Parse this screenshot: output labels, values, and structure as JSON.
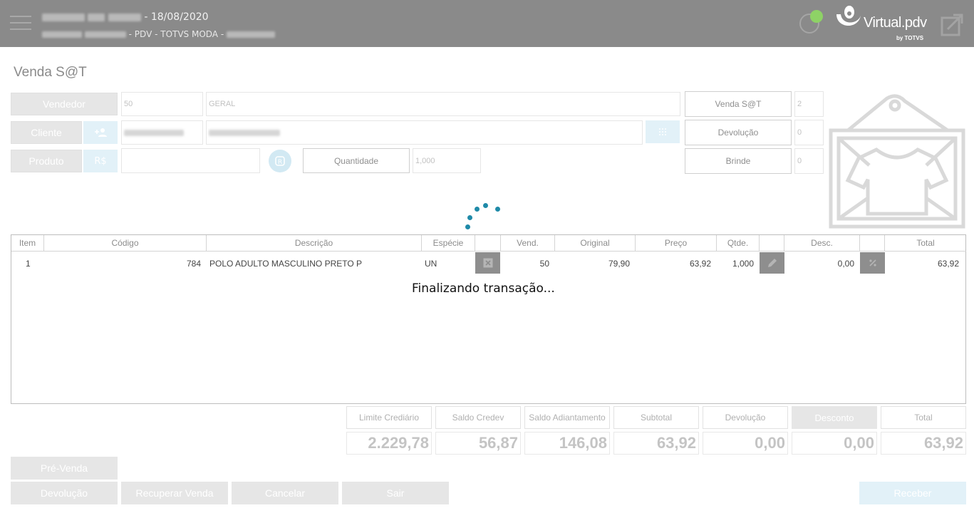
{
  "header": {
    "date_suffix": "- 18/08/2020",
    "subtitle_middle": "- PDV - TOTVS MODA -",
    "logo_text": "Virtual.pdv",
    "logo_sub": "by TOTVS"
  },
  "page_title": "Venda S@T",
  "form": {
    "vendedor_label": "Vendedor",
    "vendedor_code": "50",
    "vendedor_name": "GERAL",
    "cliente_label": "Cliente",
    "produto_label": "Produto",
    "currency_label": "R$",
    "quantidade_label": "Quantidade",
    "quantidade_value": "1,000"
  },
  "counters": [
    {
      "label": "Venda S@T",
      "value": "2"
    },
    {
      "label": "Devolução",
      "value": "0"
    },
    {
      "label": "Brinde",
      "value": "0"
    }
  ],
  "table": {
    "headers": {
      "item": "Item",
      "codigo": "Código",
      "descricao": "Descrição",
      "especie": "Espécie",
      "vend": "Vend.",
      "original": "Original",
      "preco": "Preço",
      "qtde": "Qtde.",
      "desc": "Desc.",
      "total": "Total"
    },
    "rows": [
      {
        "item": "1",
        "codigo": "784",
        "descricao": "POLO ADULTO MASCULINO PRETO P",
        "especie": "UN",
        "vend": "50",
        "original": "79,90",
        "preco": "63,92",
        "qtde": "1,000",
        "desc": "0,00",
        "total": "63,92"
      }
    ]
  },
  "loading_text": "Finalizando transação...",
  "totals": [
    {
      "label": "Limite Crediário",
      "value": "2.229,78"
    },
    {
      "label": "Saldo Credev",
      "value": "56,87"
    },
    {
      "label": "Saldo Adiantamento",
      "value": "146,08"
    },
    {
      "label": "Subtotal",
      "value": "63,92"
    },
    {
      "label": "Devolução",
      "value": "0,00"
    },
    {
      "label": "Desconto",
      "value": "0,00"
    },
    {
      "label": "Total",
      "value": "63,92"
    }
  ],
  "buttons": {
    "pre_venda": "Pré-Venda",
    "devolucao": "Devolução",
    "recuperar": "Recuperar Venda",
    "cancelar": "Cancelar",
    "sair": "Sair",
    "receber": "Receber"
  },
  "colors": {
    "header_bg": "#8a8a8a",
    "status_online": "#8ed266",
    "spinner": "#1f8aa8",
    "accent_light": "#e2f1f8"
  },
  "icons": [
    "menu-icon",
    "status-icon",
    "logo-icon",
    "expand-icon",
    "add-user-icon",
    "keypad-icon",
    "r-circle-icon",
    "delete-icon",
    "edit-icon",
    "percent-icon",
    "clothing-tag-icon"
  ]
}
